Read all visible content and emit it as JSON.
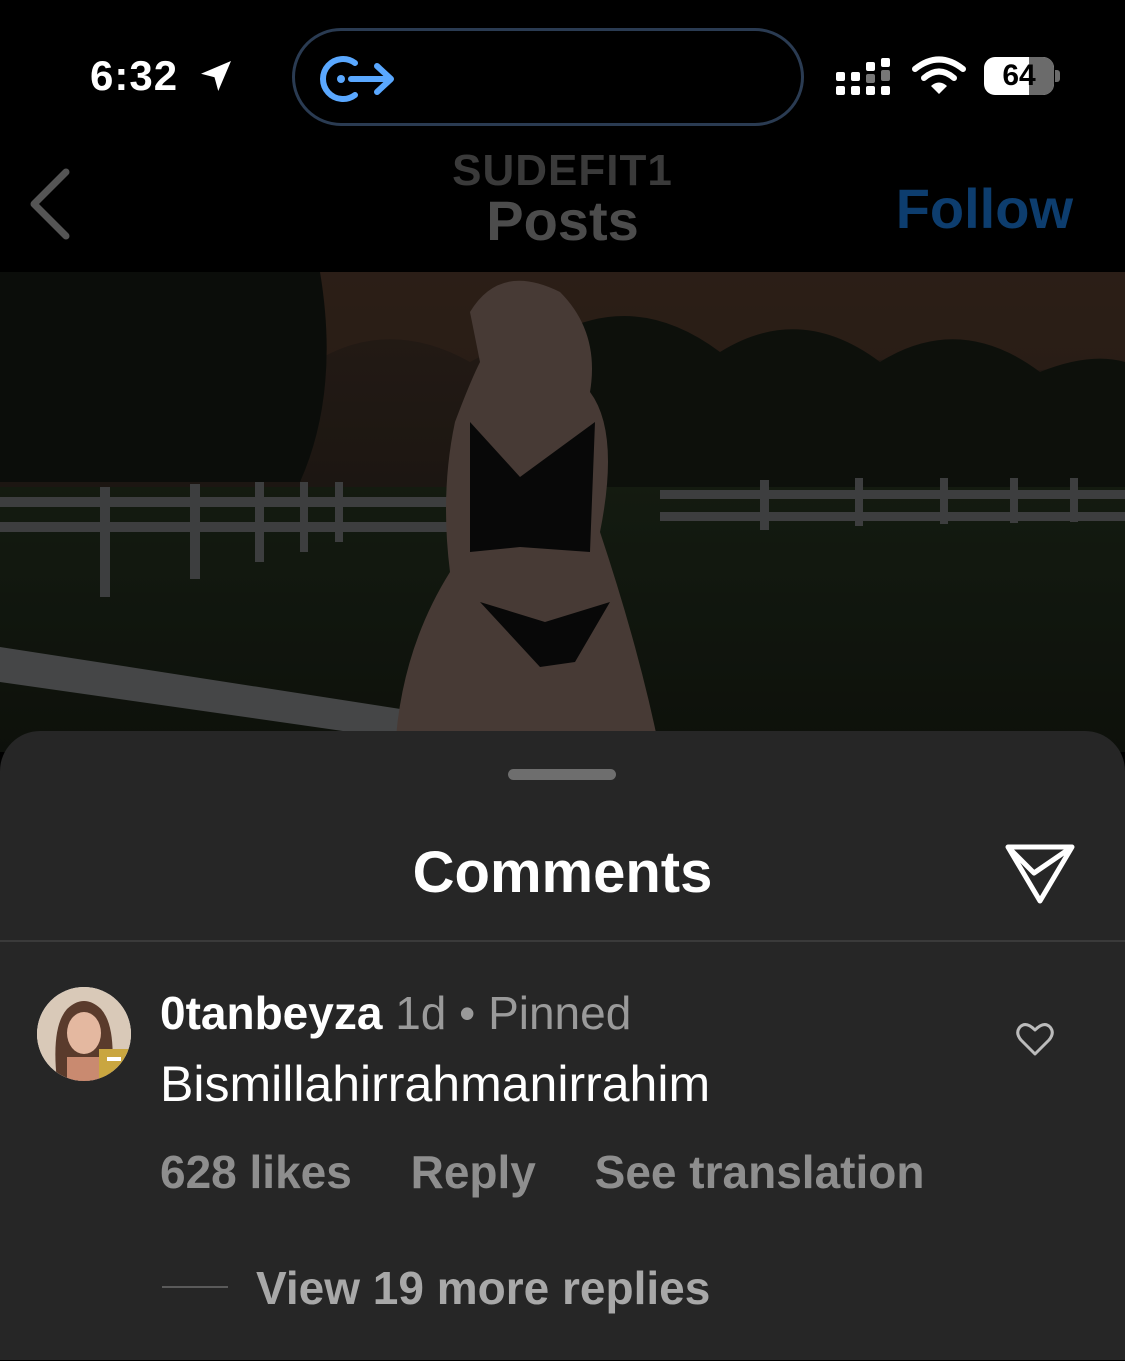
{
  "status_bar": {
    "time": "6:32",
    "battery": "64",
    "battery_level": 0.64
  },
  "header": {
    "username": "SUDEFIT1",
    "title": "Posts",
    "follow_label": "Follow"
  },
  "comments_sheet": {
    "title": "Comments",
    "comment": {
      "author": "0tanbeyza",
      "time": "1d",
      "separator": "•",
      "pinned": "Pinned",
      "text": "Bismillahirrahmanirrahim",
      "likes": "628 likes",
      "reply_label": "Reply",
      "translate_label": "See translation",
      "view_replies": "View 19 more replies"
    }
  },
  "icons": {
    "location": "location-arrow-icon",
    "island": "screen-share-icon",
    "signal": "cellular-signal-icon",
    "wifi": "wifi-icon",
    "back": "chevron-left-icon",
    "share": "paper-plane-icon",
    "like": "heart-icon"
  },
  "colors": {
    "follow": "#0d3d6e",
    "sheet_background": "#262626",
    "island_accent": "#5aa8ff"
  }
}
